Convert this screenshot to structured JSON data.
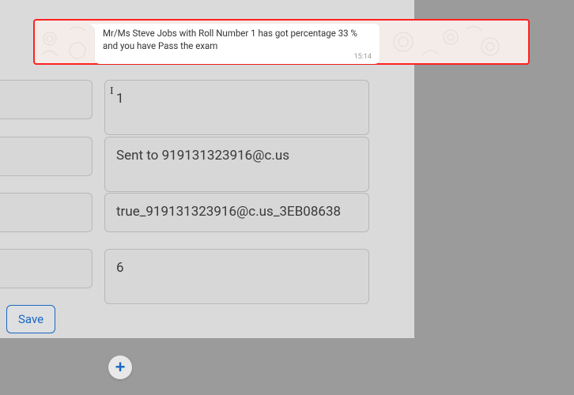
{
  "notification": {
    "message": "Mr/Ms Steve Jobs with Roll Number 1 has got percentage 33 % and you have Pass the exam",
    "time": "15:14"
  },
  "fields": {
    "row1": "1",
    "row2": "Sent to 919131323916@c.us",
    "row3": "true_919131323916@c.us_3EB08638",
    "row4": "6"
  },
  "buttons": {
    "save": "Save",
    "add": "+"
  }
}
